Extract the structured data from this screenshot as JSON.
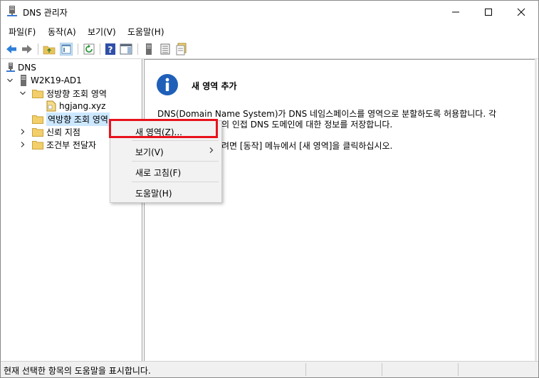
{
  "window": {
    "title": "DNS 관리자"
  },
  "menubar": {
    "items": [
      "파일(F)",
      "동작(A)",
      "보기(V)",
      "도움말(H)"
    ]
  },
  "toolbar": {
    "buttons": [
      "back-icon",
      "forward-icon",
      "up-folder-icon",
      "show-hide-console-tree-icon",
      "refresh-icon",
      "help-icon",
      "action-pane-icon",
      "server-icon",
      "list-icon",
      "properties-icon"
    ]
  },
  "tree": {
    "root": "DNS",
    "server": "W2K19-AD1",
    "forward_zone": "정방향 조회 영역",
    "forward_child": "hgjang.xyz",
    "reverse_zone": "역방향 조회 영역",
    "trust_points": "신뢰 지점",
    "conditional_forwarders": "조건부 전달자"
  },
  "content": {
    "heading": "새 영역 추가",
    "line1": "DNS(Domain Name System)가 DNS 네임스페이스를 영역으로 분할하도록 허용합니다. 각",
    "line2": "의 인접 DNS 도메인에 대한 정보를 저장합니다.",
    "line3": "려면 [동작] 메뉴에서 [새 영역]을 클릭하십시오."
  },
  "context_menu": {
    "items": [
      "새 영역(Z)...",
      "보기(V)",
      "새로 고침(F)",
      "도움말(H)"
    ]
  },
  "statusbar": {
    "text": "현재 선택한 항목의 도움말을 표시합니다."
  },
  "colors": {
    "highlight": "#e8121c",
    "selection": "#cce8ff",
    "info_icon": "#1f5fb8"
  }
}
